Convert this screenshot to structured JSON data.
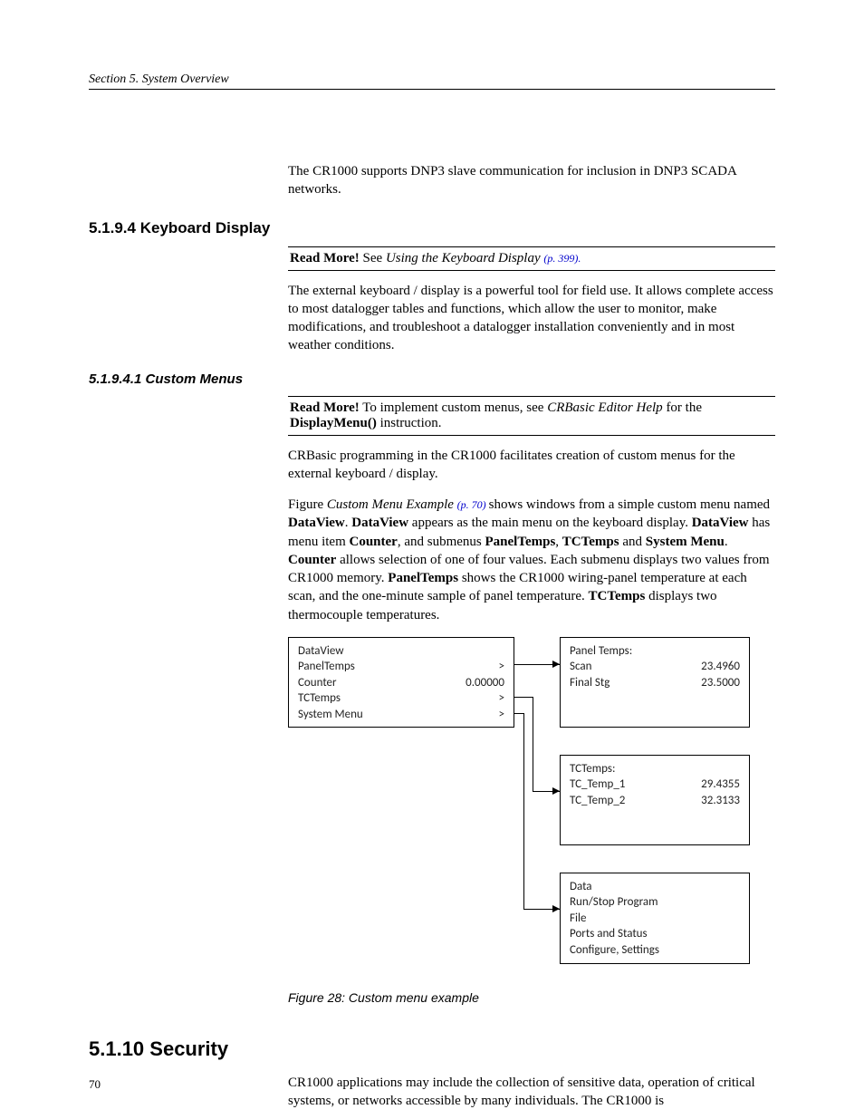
{
  "header": "Section 5.  System Overview",
  "page_number": "70",
  "intro_para": "The CR1000 supports DNP3 slave communication for inclusion in DNP3 SCADA networks.",
  "h_5_1_9_4": "5.1.9.4 Keyboard Display",
  "callout1_prefix": "Read More!",
  "callout1_mid": " See ",
  "callout1_link_text": "Using the Keyboard Display ",
  "callout1_pageref": "(p. 399).",
  "para_kbd": "The external keyboard / display is a powerful tool for field use. It allows complete access to most datalogger tables and functions, which allow the user to monitor, make modifications, and troubleshoot a datalogger installation conveniently and in most weather conditions.",
  "h_5_1_9_4_1": "5.1.9.4.1 Custom Menus",
  "callout2_prefix": "Read More!",
  "callout2_mid": " To implement custom menus, see ",
  "callout2_em": "CRBasic Editor Help",
  "callout2_rest": " for the ",
  "callout2_bold": "DisplayMenu()",
  "callout2_tail": " instruction.",
  "para_cm1": "CRBasic programming in the CR1000 facilitates creation of custom menus for the external keyboard / display.",
  "para_cm2_a": "Figure ",
  "para_cm2_em": "Custom Menu Example ",
  "para_cm2_link": "(p. 70) ",
  "para_cm2_b": "shows windows from a simple custom menu named ",
  "b_dataview": "DataView",
  "para_cm2_c": ". ",
  "para_cm2_d": " appears as the main menu on the keyboard display. ",
  "para_cm2_e": " has menu item ",
  "b_counter": "Counter",
  "para_cm2_f": ", and submenus ",
  "b_paneltemps": "PanelTemps",
  "para_cm2_g": ", ",
  "b_tctemps": "TCTemps",
  "para_cm2_h": " and ",
  "b_sysmenu": "System Menu",
  "para_cm2_i": ". ",
  "para_cm2_j": " allows selection of one of four values. Each submenu displays two values from CR1000 memory. ",
  "para_cm2_k": " shows the CR1000 wiring‐panel temperature at each scan, and the one‑minute sample of panel temperature. ",
  "para_cm2_l": " displays two thermocouple temperatures.",
  "figure": {
    "caption": "Figure 28: Custom menu example",
    "main": {
      "title": "DataView",
      "items": [
        {
          "label": "PanelTemps",
          "val": ">"
        },
        {
          "label": "Counter",
          "val": "0.00000"
        },
        {
          "label": "TCTemps",
          "val": ">"
        },
        {
          "label": "System Menu",
          "val": ">"
        }
      ]
    },
    "panel_pt": {
      "title": "Panel Temps:",
      "rows": [
        {
          "label": "Scan",
          "val": "23.4960"
        },
        {
          "label": "Final Stg",
          "val": "23.5000"
        }
      ]
    },
    "panel_tc": {
      "title": "TCTemps:",
      "rows": [
        {
          "label": "TC_Temp_1",
          "val": "29.4355"
        },
        {
          "label": "TC_Temp_2",
          "val": "32.3133"
        }
      ]
    },
    "panel_sys": {
      "lines": [
        "Data",
        "Run/Stop Program",
        "File",
        "Ports and Status",
        "Configure, Settings"
      ]
    }
  },
  "h_5_1_10": "5.1.10 Security",
  "para_sec": "CR1000 applications may include the collection of sensitive data, operation of critical systems, or networks accessible by many individuals.  The CR1000 is"
}
